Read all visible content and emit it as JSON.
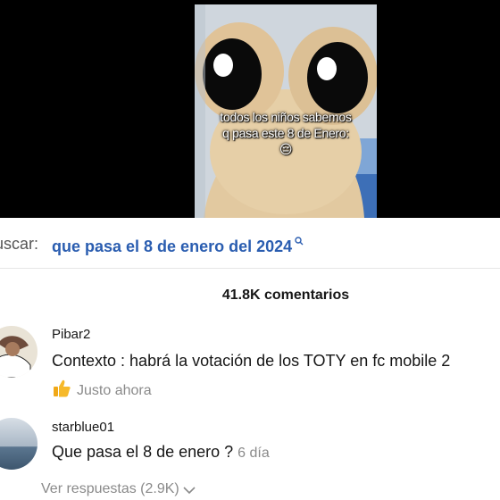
{
  "video": {
    "caption_line1": "todos los niños sabemos",
    "caption_line2": "q pasa este 8 de Enero:",
    "caption_emoji": "😔"
  },
  "search": {
    "prefix": "uscar:",
    "query": "que pasa el 8 de enero del 2024",
    "query_icon": "search-icon"
  },
  "comments_header": {
    "count_label": "41.8K comentarios"
  },
  "comments": [
    {
      "username": "Pibar2",
      "text": "Contexto : habrá la votación de los TOTY en fc mobile 2",
      "time": "Justo ahora",
      "icon": "thumbs-up-icon"
    },
    {
      "username": "starblue01",
      "text": "Que pasa el 8 de enero ?",
      "time": "6 día"
    }
  ],
  "replies": {
    "label": "Ver respuestas (2.9K)"
  },
  "colors": {
    "accent_link": "#2a5db0",
    "muted_text": "#8a8a8a",
    "background_video": "#000000"
  }
}
